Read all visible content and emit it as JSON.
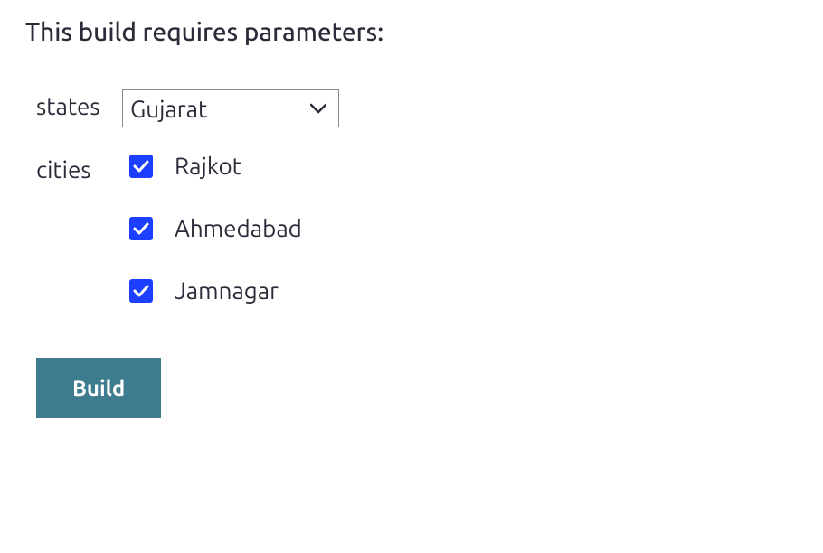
{
  "heading": "This build requires parameters:",
  "parameters": {
    "states": {
      "label": "states",
      "selected": "Gujarat"
    },
    "cities": {
      "label": "cities",
      "options": [
        {
          "label": "Rajkot",
          "checked": true
        },
        {
          "label": "Ahmedabad",
          "checked": true
        },
        {
          "label": "Jamnagar",
          "checked": true
        }
      ]
    }
  },
  "buildButton": "Build"
}
